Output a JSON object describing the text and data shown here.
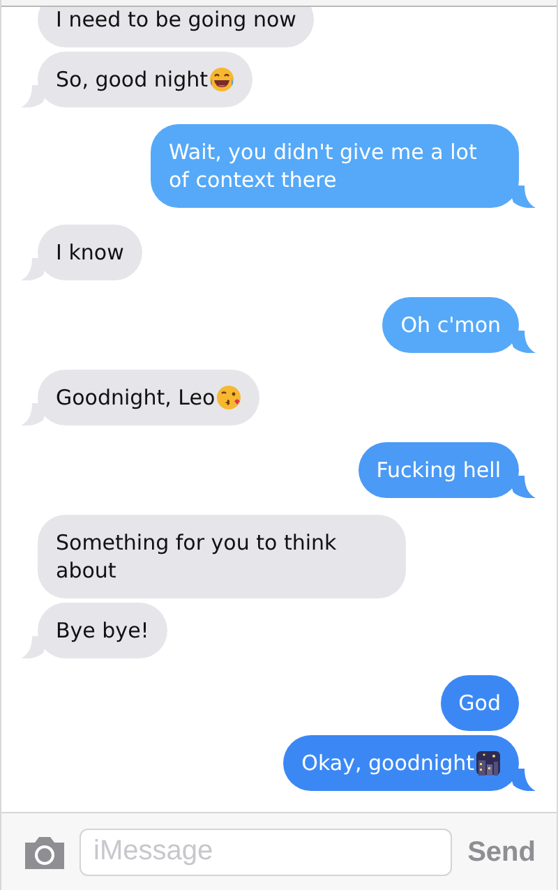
{
  "messages": [
    {
      "kind": "received",
      "text": "I need to be going now",
      "tail": false
    },
    {
      "kind": "received",
      "text": "So, good night",
      "emoji": {
        "kind": "laughing"
      },
      "tail": true
    },
    {
      "kind": "sent",
      "text": "Wait, you didn't give me a lot of context there",
      "tail": true,
      "color": "#55a9f8"
    },
    {
      "kind": "received",
      "text": "I know",
      "tail": true
    },
    {
      "kind": "sent",
      "text": "Oh c'mon",
      "tail": true,
      "color": "#55a9f8"
    },
    {
      "kind": "received",
      "text": "Goodnight, Leo",
      "emoji": {
        "kind": "kiss"
      },
      "tail": true
    },
    {
      "kind": "sent",
      "text": "Fucking hell",
      "tail": true,
      "color": "#4a9af6"
    },
    {
      "kind": "received",
      "text": "Something for you to think about",
      "tail": false
    },
    {
      "kind": "received",
      "text": "Bye bye!",
      "tail": true
    },
    {
      "kind": "sent",
      "text": "God",
      "tail": false,
      "color": "#3b88f5"
    },
    {
      "kind": "sent",
      "text": "Okay, goodnight",
      "emoji": {
        "kind": "night"
      },
      "tail": true,
      "color": "#3b88f5"
    }
  ],
  "composer": {
    "placeholder": "iMessage",
    "send": "Send"
  }
}
